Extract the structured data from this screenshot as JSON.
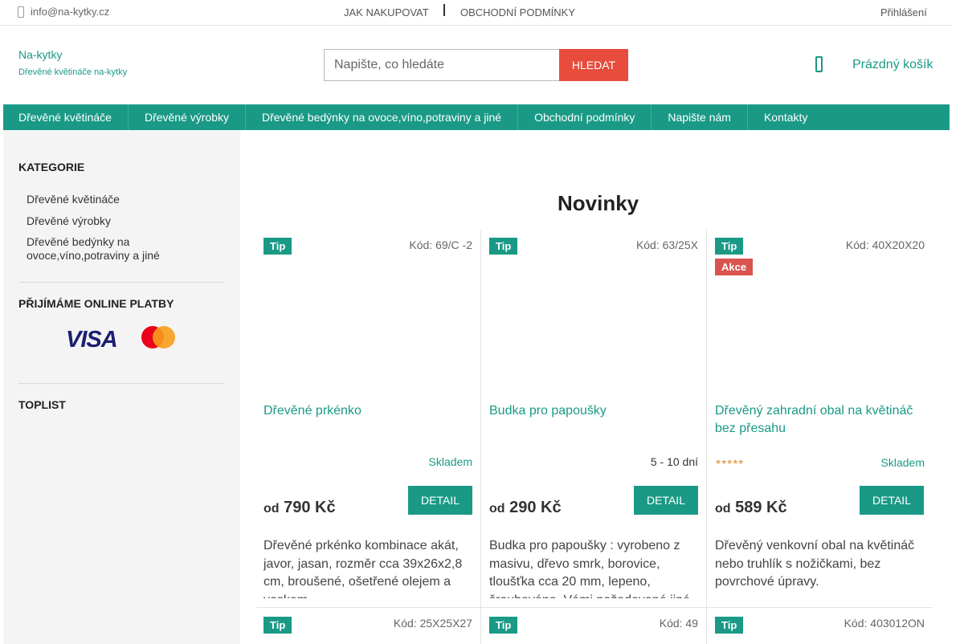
{
  "topbar": {
    "email": "info@na-kytky.cz",
    "link_how": "JAK NAKUPOVAT",
    "link_terms": "OBCHODNÍ PODMÍNKY",
    "login": "Přihlášení"
  },
  "header": {
    "logo_title": "Na-kytky",
    "logo_subtitle": "Dřevěné květináče na-kytky",
    "search_placeholder": "Napište, co hledáte",
    "search_button": "HLEDAT",
    "cart_label": "Prázdný košík"
  },
  "menu": [
    "Dřevěné květináče",
    "Dřevěné výrobky",
    "Dřevěné bedýnky na ovoce,víno,potraviny a jiné",
    "Obchodní podmínky",
    "Napište nám",
    "Kontakty"
  ],
  "sidebar": {
    "categories_title": "KATEGORIE",
    "categories": [
      "Dřevěné květináče",
      "Dřevěné výrobky",
      "Dřevěné bedýnky na ovoce,víno,potraviny a jiné"
    ],
    "payments_title": "PŘIJÍMÁME ONLINE PLATBY",
    "visa_label": "VISA",
    "toplist_title": "TOPLIST"
  },
  "main": {
    "section_title": "Novinky",
    "products": [
      {
        "tag": "Tip",
        "tag2": "",
        "code": "Kód: 69/C -2",
        "name": "Dřevěné prkénko",
        "availability": "Skladem",
        "price_prefix": "od",
        "price": "790 Kč",
        "detail": "DETAIL",
        "description": "Dřevěné prkénko kombinace akát, javor, jasan, rozměr cca 39x26x2,8 cm, broušené, ošetřené olejem a voskem"
      },
      {
        "tag": "Tip",
        "tag2": "",
        "code": "Kód: 63/25X",
        "name": "Budka pro papoušky",
        "availability": "5 - 10 dní",
        "price_prefix": "od",
        "price": "290 Kč",
        "detail": "DETAIL",
        "description": "Budka pro papoušky : vyrobeno z masivu, dřevo smrk, borovice, tloušťka cca 20 mm, lepeno, šroubováno. Vámi požadované jiné"
      },
      {
        "tag": "Tip",
        "tag2": "Akce",
        "code": "Kód: 40X20X20",
        "name": "Dřevěný zahradní obal na květináč bez přesahu",
        "availability": "Skladem",
        "rating_stars": 5,
        "price_prefix": "od",
        "price": "589 Kč",
        "detail": "DETAIL",
        "description": "Dřevěný venkovní obal na květináč nebo truhlík s nožičkami, bez povrchové úpravy."
      }
    ],
    "products_row2": [
      {
        "tag": "Tip",
        "code": "Kód: 25X25X27"
      },
      {
        "tag": "Tip",
        "code": "Kód: 49"
      },
      {
        "tag": "Tip",
        "code": "Kód: 403012ON"
      }
    ]
  },
  "colors": {
    "accent": "#1a9a86",
    "search_button": "#e74c3c",
    "akce": "#d9534f"
  }
}
